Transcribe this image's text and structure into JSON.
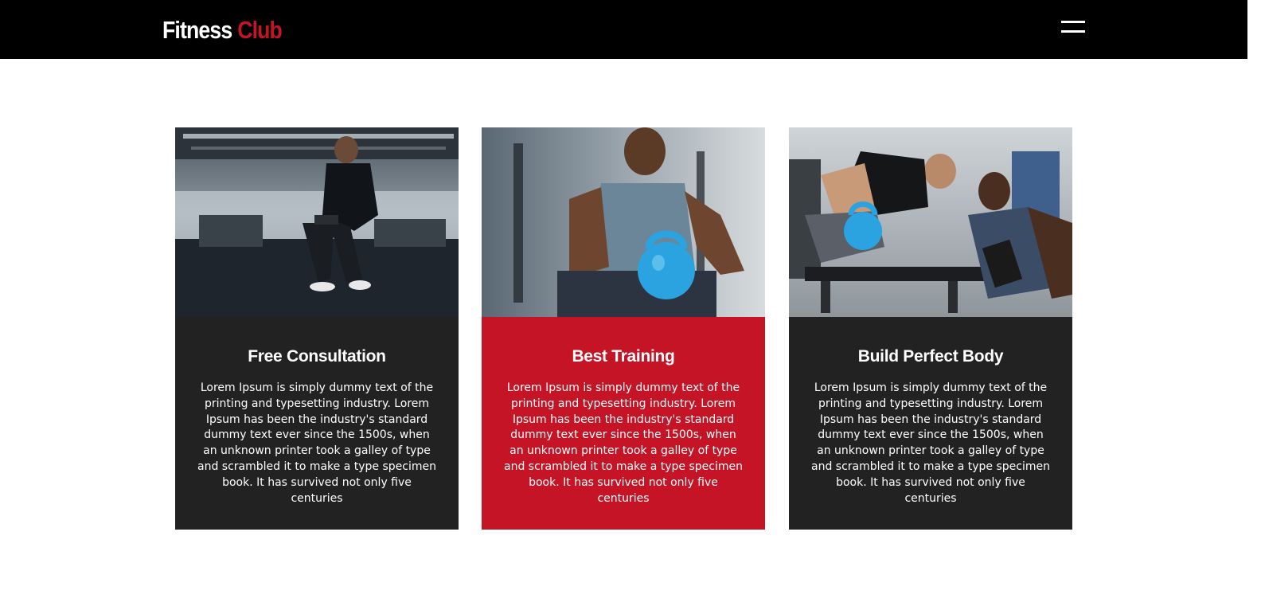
{
  "header": {
    "logo_word1": "Fitness",
    "logo_word2": "Club",
    "menu_icon": "hamburger-menu-icon"
  },
  "colors": {
    "header_bg": "#000000",
    "accent": "#c41426",
    "card_dark": "#222222",
    "text_light": "#ffffff"
  },
  "cards": [
    {
      "title": "Free Consultation",
      "text": "Lorem Ipsum is simply dummy text of the printing and typesetting industry. Lorem Ipsum has been the industry's standard dummy text ever since the 1500s, when an unknown printer took a galley of type and scrambled it to make a type specimen book. It has survived not only five centuries",
      "style": "dark"
    },
    {
      "title": "Best Training",
      "text": "Lorem Ipsum is simply dummy text of the printing and typesetting industry. Lorem Ipsum has been the industry's standard dummy text ever since the 1500s, when an unknown printer took a galley of type and scrambled it to make a type specimen book. It has survived not only five centuries",
      "style": "accent"
    },
    {
      "title": "Build Perfect Body",
      "text": "Lorem Ipsum is simply dummy text of the printing and typesetting industry. Lorem Ipsum has been the industry's standard dummy text ever since the 1500s, when an unknown printer took a galley of type and scrambled it to make a type specimen book. It has survived not only five centuries",
      "style": "dark"
    }
  ]
}
